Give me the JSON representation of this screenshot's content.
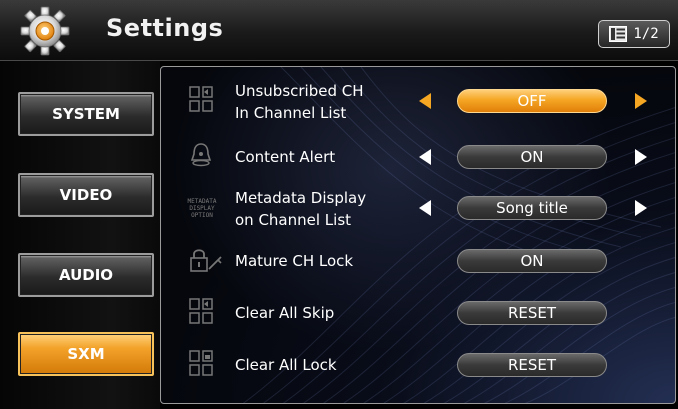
{
  "header": {
    "title": "Settings",
    "page_indicator": "1/2"
  },
  "sidebar": {
    "items": [
      {
        "label": "SYSTEM",
        "active": false
      },
      {
        "label": "VIDEO",
        "active": false
      },
      {
        "label": "AUDIO",
        "active": false
      },
      {
        "label": "SXM",
        "active": true
      }
    ]
  },
  "settings": [
    {
      "icon": "channel-list-icon",
      "label_line1": "Unsubscribed CH",
      "label_line2": "In Channel List",
      "value": "OFF",
      "has_arrows": true,
      "highlighted": true
    },
    {
      "icon": "alert-bell-icon",
      "label_line1": "Content Alert",
      "value": "ON",
      "has_arrows": true,
      "highlighted": false
    },
    {
      "icon": "metadata-icon",
      "icon_text": "METADATA DISPLAY OPTION",
      "label_line1": "Metadata Display",
      "label_line2": "on Channel List",
      "value": "Song title",
      "has_arrows": true,
      "highlighted": false
    },
    {
      "icon": "lock-key-icon",
      "label_line1": "Mature CH Lock",
      "value": "ON",
      "has_arrows": false,
      "highlighted": false
    },
    {
      "icon": "skip-grid-icon",
      "label_line1": "Clear All Skip",
      "value": "RESET",
      "has_arrows": false,
      "highlighted": false
    },
    {
      "icon": "lock-grid-icon",
      "label_line1": "Clear All Lock",
      "value": "RESET",
      "has_arrows": false,
      "highlighted": false
    }
  ],
  "colors": {
    "accent": "#f5a623",
    "background": "#000000",
    "pill": "#3a3a3a"
  }
}
